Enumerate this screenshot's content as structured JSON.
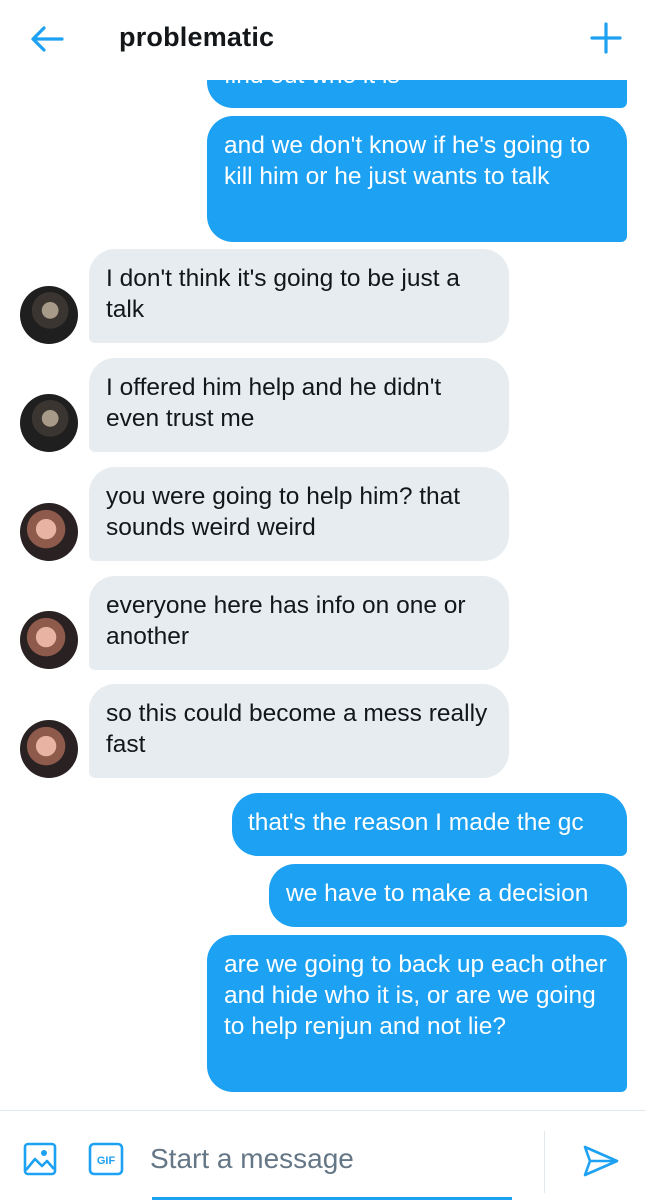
{
  "header": {
    "title": "problematic"
  },
  "messages": [
    {
      "dir": "out",
      "text": "find out who it is"
    },
    {
      "dir": "out",
      "text": "and we don't know if he's going to kill him or he just wants to talk"
    },
    {
      "dir": "in",
      "text": "I don't think it's going to be just a talk"
    },
    {
      "dir": "in",
      "text": "I offered him help and he didn't even trust me"
    },
    {
      "dir": "in",
      "text": "you were going to help him? that sounds weird weird"
    },
    {
      "dir": "in",
      "text": "everyone here has info on one or another"
    },
    {
      "dir": "in",
      "text": "so this could become a mess really fast"
    },
    {
      "dir": "out",
      "text": "that's the reason I made the gc"
    },
    {
      "dir": "out",
      "text": "we have to make a decision"
    },
    {
      "dir": "out",
      "text": "are we going to back up each other and hide who it is, or are we going to help renjun and not lie?"
    }
  ],
  "composer": {
    "placeholder": "Start a message",
    "gif_label": "GIF"
  },
  "colors": {
    "accent": "#1da1f2",
    "incoming": "#e6ecf0"
  }
}
